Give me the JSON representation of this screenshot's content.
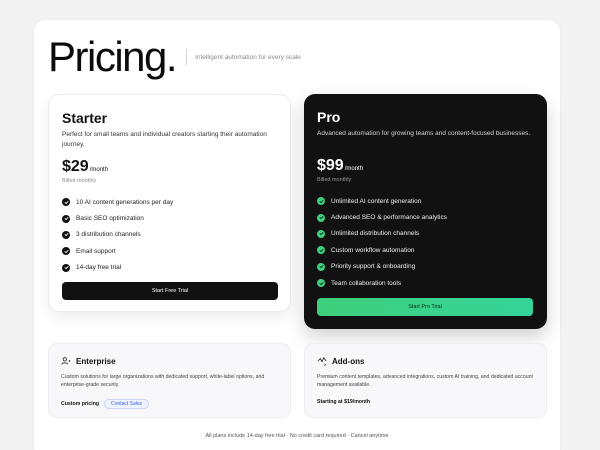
{
  "header": {
    "title": "Pricing.",
    "tagline": "Intelligent automation for every scale"
  },
  "plans": {
    "starter": {
      "name": "Starter",
      "description": "Perfect for small teams and individual creators starting their automation journey.",
      "price": "$29",
      "period": "/month",
      "billing": "Billed monthly",
      "features": [
        "10 AI content generations per day",
        "Basic SEO optimization",
        "3 distribution channels",
        "Email support",
        "14-day free trial"
      ],
      "cta": "Start Free Trial"
    },
    "pro": {
      "name": "Pro",
      "description": "Advanced automation for growing teams and content-focused businesses.",
      "price": "$99",
      "period": "/month",
      "billing": "Billed monthly",
      "features": [
        "Unlimited AI content generation",
        "Advanced SEO & performance analytics",
        "Unlimited distribution channels",
        "Custom workflow automation",
        "Priority support & onboarding",
        "Team collaboration tools"
      ],
      "cta": "Start Pro Trial"
    }
  },
  "enterprise": {
    "icon": "user-group-icon",
    "title": "Enterprise",
    "description": "Custom solutions for large organizations with dedicated support, white-label options, and enterprise-grade security.",
    "pricing_label": "Custom pricing",
    "contact_label": "Contact Sales"
  },
  "addons": {
    "icon": "sparkle-icon",
    "title": "Add-ons",
    "description": "Premium content templates, advanced integrations, custom AI training, and dedicated account management available.",
    "starting_label": "Starting at $19/month"
  },
  "footer": {
    "note": "All plans include 14-day free trial · No credit card required · Cancel anytime"
  },
  "colors": {
    "accent_green": "#3ecf7c",
    "pro_background": "#111112",
    "link_blue": "#3b66d6"
  }
}
